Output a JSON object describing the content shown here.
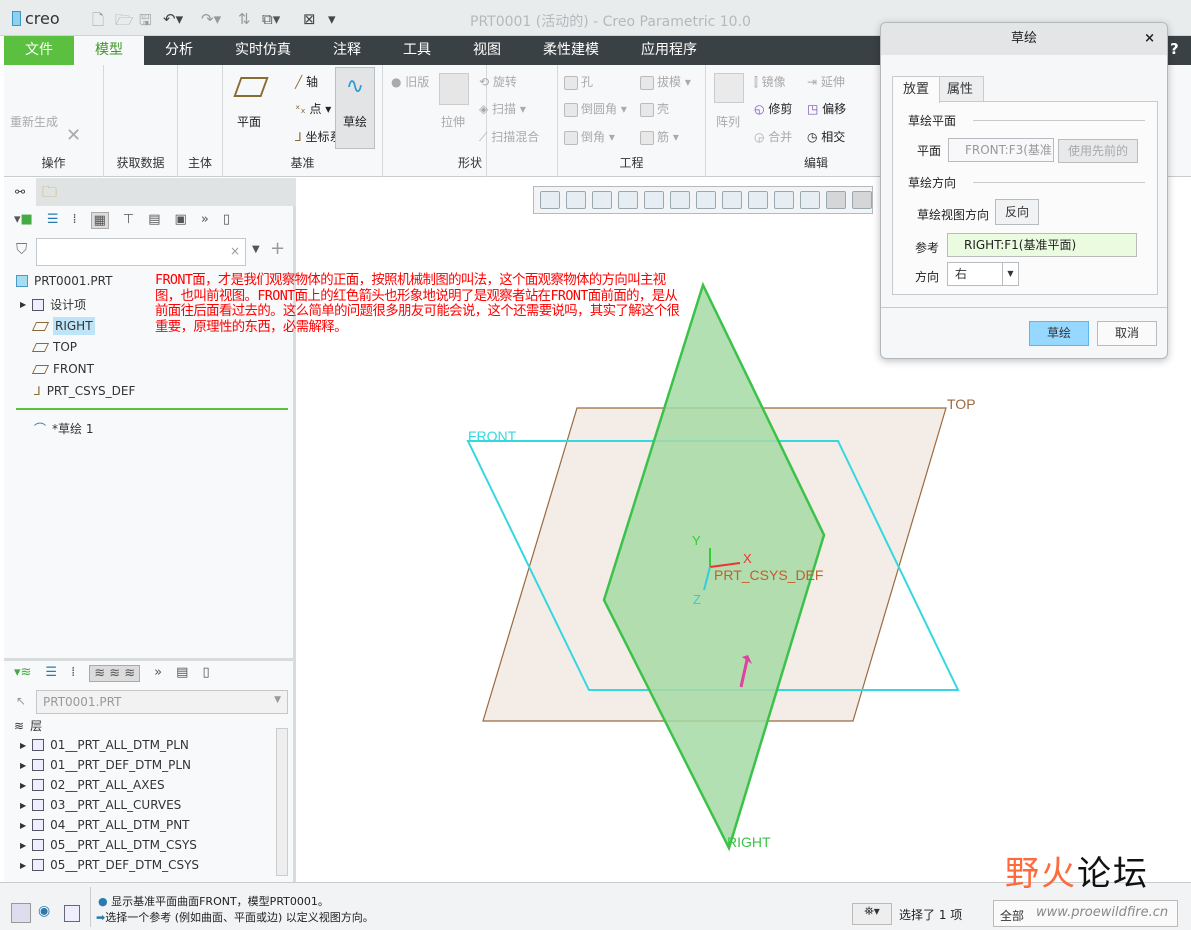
{
  "app": {
    "logo": "creo",
    "title": "PRT0001 (活动的) - Creo Parametric 10.0"
  },
  "tabs": [
    "文件",
    "模型",
    "分析",
    "实时仿真",
    "注释",
    "工具",
    "视图",
    "柔性建模",
    "应用程序"
  ],
  "ribbon": {
    "ops": {
      "label": "操作",
      "regen": "重新生成"
    },
    "getdata": {
      "label": "获取数据"
    },
    "body": {
      "label": "主体"
    },
    "datum": {
      "label": "基准",
      "plane": "平面",
      "axis": "轴",
      "point": "点",
      "csys": "坐标系",
      "sketch": "草绘"
    },
    "shape": {
      "label": "形状",
      "legacy": "旧版",
      "extrude": "拉伸",
      "revolve": "旋转",
      "sweep": "扫描",
      "swept_blend": "扫描混合"
    },
    "eng": {
      "label": "工程",
      "hole": "孔",
      "round": "倒圆角",
      "chamfer": "倒角",
      "draft": "拔模",
      "shell": "壳",
      "rib": "筋"
    },
    "edit": {
      "label": "编辑",
      "pattern": "阵列",
      "mirror": "镜像",
      "extend": "延伸",
      "trim": "修剪",
      "offset": "偏移",
      "merge": "合并",
      "intersect": "相交"
    }
  },
  "model_tree": {
    "root": "PRT0001.PRT",
    "items": [
      "设计项",
      "RIGHT",
      "TOP",
      "FRONT",
      "PRT_CSYS_DEF"
    ],
    "selected": "RIGHT",
    "insert": "*草绘 1"
  },
  "layer_tree": {
    "model": "PRT0001.PRT",
    "header": "层",
    "items": [
      "01__PRT_ALL_DTM_PLN",
      "01__PRT_DEF_DTM_PLN",
      "02__PRT_ALL_AXES",
      "03__PRT_ALL_CURVES",
      "04__PRT_ALL_DTM_PNT",
      "05__PRT_ALL_DTM_CSYS",
      "05__PRT_DEF_DTM_CSYS"
    ]
  },
  "annotation": "FRONT面，才是我们观察物体的正面，按照机械制图的叫法，这个面观察物体的方向叫主视图，也叫前视图。FRONT面上的红色箭头也形象地说明了是观察者站在FRONT面前面的，是从前面往后面看过去的。这么简单的问题很多朋友可能会说，这个还需要说吗，其实了解这个很重要，原理性的东西，必需解释。",
  "viewport": {
    "labels": {
      "top": "TOP",
      "front": "FRONT",
      "right": "RIGHT",
      "csys": "PRT_CSYS_DEF",
      "x": "X",
      "y": "Y",
      "z": "Z"
    },
    "colors": {
      "front": "#35d8e0",
      "top": "#9a6a40",
      "right": "#3cc24a"
    }
  },
  "dialog": {
    "title": "草绘",
    "tabs": [
      "放置",
      "属性"
    ],
    "sketch_plane_section": "草绘平面",
    "plane_label": "平面",
    "plane_value": "FRONT:F3(基准",
    "use_previous": "使用先前的",
    "orientation_section": "草绘方向",
    "view_dir_label": "草绘视图方向",
    "flip": "反向",
    "reference_label": "参考",
    "reference_value": "RIGHT:F1(基准平面)",
    "direction_label": "方向",
    "direction_value": "右",
    "ok": "草绘",
    "cancel": "取消"
  },
  "status": {
    "msg1": "显示基准平面曲面FRONT，模型PRT0001。",
    "msg2": "选择一个参考 (例如曲面、平面或边) 以定义视图方向。",
    "selected": "选择了 1 项",
    "filter": "全部"
  },
  "watermark": {
    "text": "野火论坛",
    "url": "www.proewildfire.cn"
  }
}
